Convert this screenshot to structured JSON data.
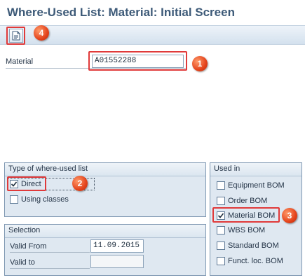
{
  "window": {
    "title": "Where-Used List: Material: Initial Screen"
  },
  "toolbar": {
    "execute_icon": "execute-report-icon",
    "badge": "4"
  },
  "material": {
    "label": "Material",
    "value": "A01552288",
    "badge": "1"
  },
  "type_group": {
    "title": "Type of where-used list",
    "direct": {
      "label": "Direct",
      "checked": true,
      "badge": "2"
    },
    "using_classes": {
      "label": "Using classes",
      "checked": false
    }
  },
  "selection": {
    "title": "Selection",
    "valid_from_label": "Valid From",
    "valid_from_value": "11.09.2015",
    "valid_to_label": "Valid to",
    "valid_to_value": ""
  },
  "used_in": {
    "title": "Used in",
    "items": [
      {
        "label": "Equipment BOM",
        "checked": false
      },
      {
        "label": "Order BOM",
        "checked": false
      },
      {
        "label": "Material BOM",
        "checked": true
      },
      {
        "label": "WBS BOM",
        "checked": false
      },
      {
        "label": "Standard BOM",
        "checked": false
      },
      {
        "label": "Funct. loc. BOM",
        "checked": false
      }
    ],
    "badge": "3"
  },
  "colors": {
    "title": "#3d5a78",
    "highlight": "#e03a3a",
    "badge": "#e4431b",
    "group_bg": "#dfe8f1"
  }
}
